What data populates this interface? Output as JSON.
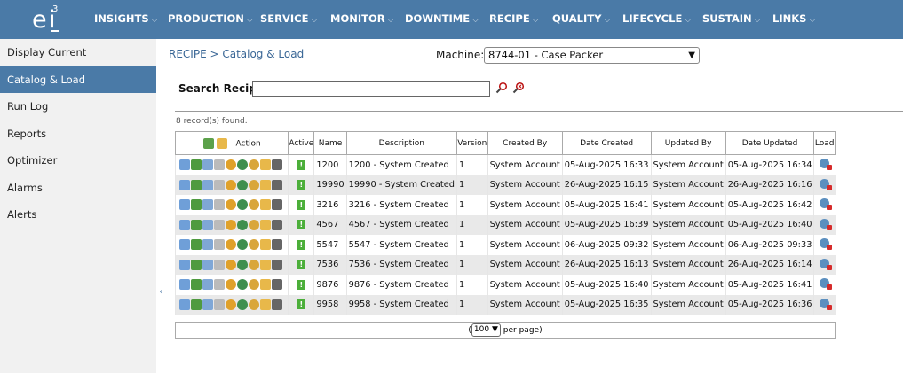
{
  "logo": {
    "e": "e",
    "i": "i",
    "sup": "3"
  },
  "nav": [
    {
      "label": "INSIGHTS",
      "chevron": "⌵"
    },
    {
      "label": "PRODUCTION",
      "chevron": "⌵"
    },
    {
      "label": "SERVICE",
      "chevron": "⌵"
    },
    {
      "label": "MONITOR",
      "chevron": "⌵"
    },
    {
      "label": "DOWNTIME",
      "chevron": "⌵"
    },
    {
      "label": "RECIPE",
      "chevron": "⌵"
    },
    {
      "label": "QUALITY",
      "chevron": "⌵"
    },
    {
      "label": "LIFECYCLE",
      "chevron": "⌵"
    },
    {
      "label": "SUSTAIN",
      "chevron": "⌵"
    },
    {
      "label": "LINKS",
      "chevron": "⌵"
    }
  ],
  "sidebar": {
    "items": [
      {
        "label": "Display Current"
      },
      {
        "label": "Catalog & Load"
      },
      {
        "label": "Run Log"
      },
      {
        "label": "Reports"
      },
      {
        "label": "Optimizer"
      },
      {
        "label": "Alarms"
      },
      {
        "label": "Alerts"
      }
    ],
    "collapse": "‹"
  },
  "breadcrumb": "RECIPE > Catalog & Load",
  "machine": {
    "label": "Machine:",
    "value": "8744-01 - Case Packer"
  },
  "search": {
    "label": "Search Recipe",
    "value": ""
  },
  "records_found": "8 record(s) found.",
  "table": {
    "headers": [
      "Action",
      "Active",
      "Name",
      "Description",
      "Version",
      "Created By",
      "Date Created",
      "Updated By",
      "Date Updated",
      "Load"
    ],
    "rows": [
      {
        "active": "!",
        "name": "1200",
        "description": "1200 - System Created",
        "version": "1",
        "created_by": "System Account",
        "date_created": "05-Aug-2025 16:33",
        "updated_by": "System Account",
        "date_updated": "05-Aug-2025 16:34"
      },
      {
        "active": "!",
        "name": "19990",
        "description": "19990 - System Created",
        "version": "1",
        "created_by": "System Account",
        "date_created": "26-Aug-2025 16:15",
        "updated_by": "System Account",
        "date_updated": "26-Aug-2025 16:16"
      },
      {
        "active": "!",
        "name": "3216",
        "description": "3216 - System Created",
        "version": "1",
        "created_by": "System Account",
        "date_created": "05-Aug-2025 16:41",
        "updated_by": "System Account",
        "date_updated": "05-Aug-2025 16:42"
      },
      {
        "active": "!",
        "name": "4567",
        "description": "4567 - System Created",
        "version": "1",
        "created_by": "System Account",
        "date_created": "05-Aug-2025 16:39",
        "updated_by": "System Account",
        "date_updated": "05-Aug-2025 16:40"
      },
      {
        "active": "!",
        "name": "5547",
        "description": "5547 - System Created",
        "version": "1",
        "created_by": "System Account",
        "date_created": "06-Aug-2025 09:32",
        "updated_by": "System Account",
        "date_updated": "06-Aug-2025 09:33"
      },
      {
        "active": "!",
        "name": "7536",
        "description": "7536 - System Created",
        "version": "1",
        "created_by": "System Account",
        "date_created": "26-Aug-2025 16:13",
        "updated_by": "System Account",
        "date_updated": "26-Aug-2025 16:14"
      },
      {
        "active": "!",
        "name": "9876",
        "description": "9876 - System Created",
        "version": "1",
        "created_by": "System Account",
        "date_created": "05-Aug-2025 16:40",
        "updated_by": "System Account",
        "date_updated": "05-Aug-2025 16:41"
      },
      {
        "active": "!",
        "name": "9958",
        "description": "9958 - System Created",
        "version": "1",
        "created_by": "System Account",
        "date_created": "05-Aug-2025 16:35",
        "updated_by": "System Account",
        "date_updated": "05-Aug-2025 16:36"
      }
    ]
  },
  "pager": {
    "open": "(",
    "per_page_value": "100",
    "per_page_suffix": "per page)"
  },
  "colors": {
    "nav_bg": "#4a7aa7",
    "active_sidebar": "#4a7aa7",
    "active_flag": "#4caf3a",
    "row_alt": "#e9e9e9"
  }
}
